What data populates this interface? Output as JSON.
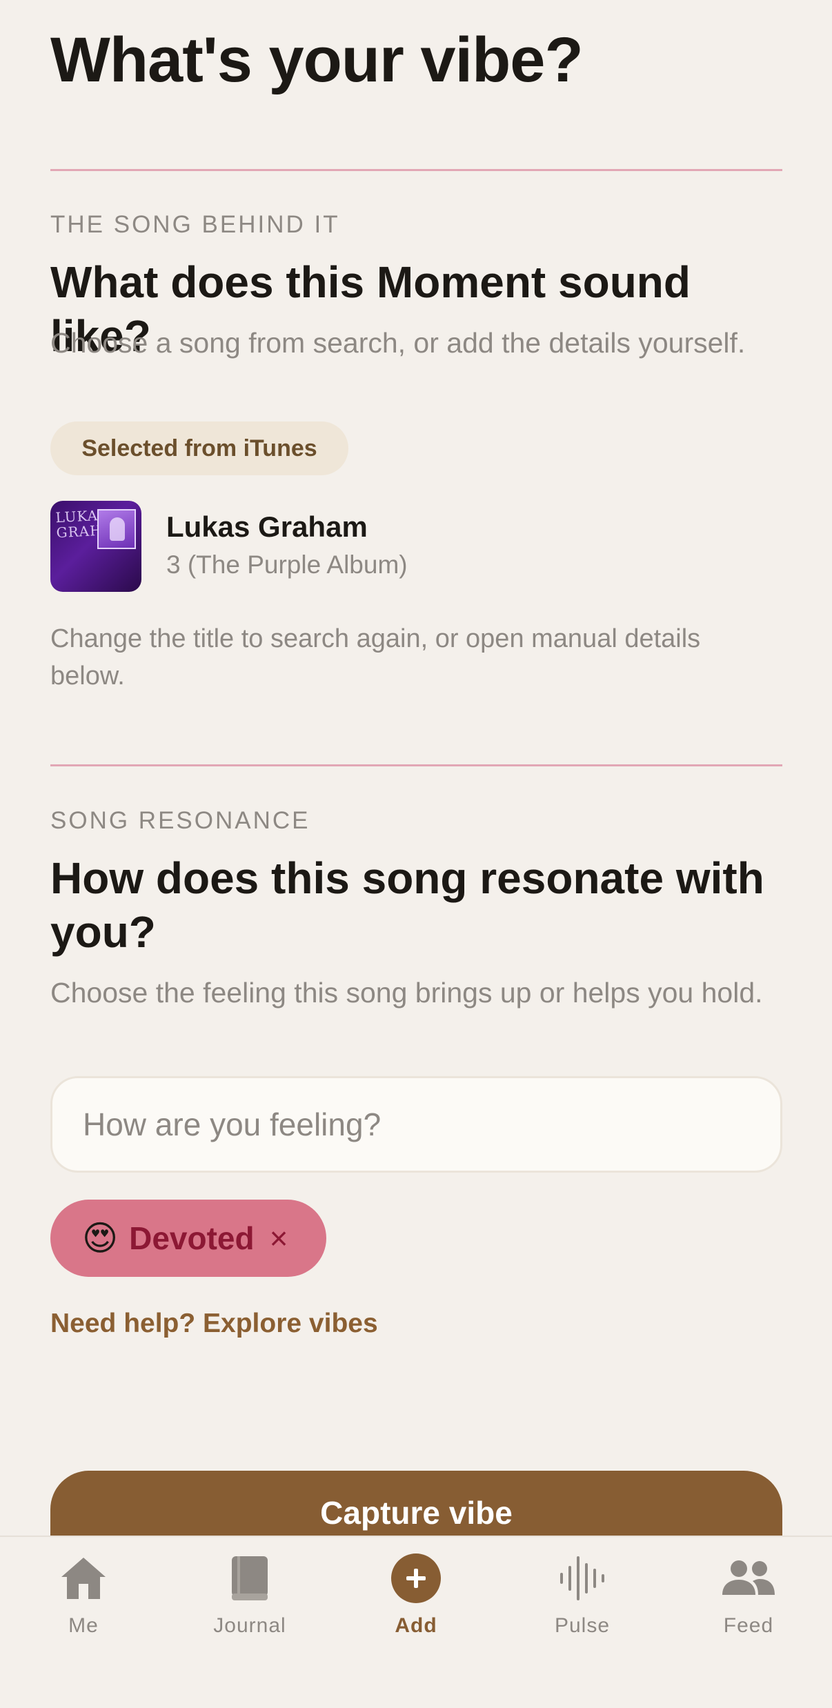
{
  "header": {
    "title": "What's your vibe?"
  },
  "song_section": {
    "eyebrow": "THE SONG BEHIND IT",
    "heading": "What does this Moment sound like?",
    "description": "Choose a song from search, or add the details yourself.",
    "source_pill": "Selected from iTunes",
    "album_art_text": "LUKAS GRAHAM",
    "artist": "Lukas Graham",
    "album": "3 (The Purple Album)",
    "hint": "Change the title to search again, or open manual details below."
  },
  "resonance_section": {
    "eyebrow": "SONG RESONANCE",
    "heading": "How does this song resonate with you?",
    "description": "Choose the feeling this song brings up or helps you hold.",
    "input_placeholder": "How are you feeling?",
    "input_value": "",
    "selected_chip": {
      "emoji": "😍",
      "label": "Devoted",
      "remove": "×"
    },
    "help_link": "Need help? Explore vibes"
  },
  "cta": {
    "label": "Capture vibe"
  },
  "tabbar": {
    "tabs": [
      {
        "label": "Me",
        "icon": "home-icon",
        "active": false
      },
      {
        "label": "Journal",
        "icon": "book-icon",
        "active": false
      },
      {
        "label": "Add",
        "icon": "plus-icon",
        "active": true
      },
      {
        "label": "Pulse",
        "icon": "soundwave-icon",
        "active": false
      },
      {
        "label": "Feed",
        "icon": "people-icon",
        "active": false
      }
    ]
  },
  "colors": {
    "background": "#f4f0eb",
    "accent": "#875d33",
    "divider": "#e2a7b5",
    "chip": "#d97689",
    "chip_text": "#8c1834"
  }
}
